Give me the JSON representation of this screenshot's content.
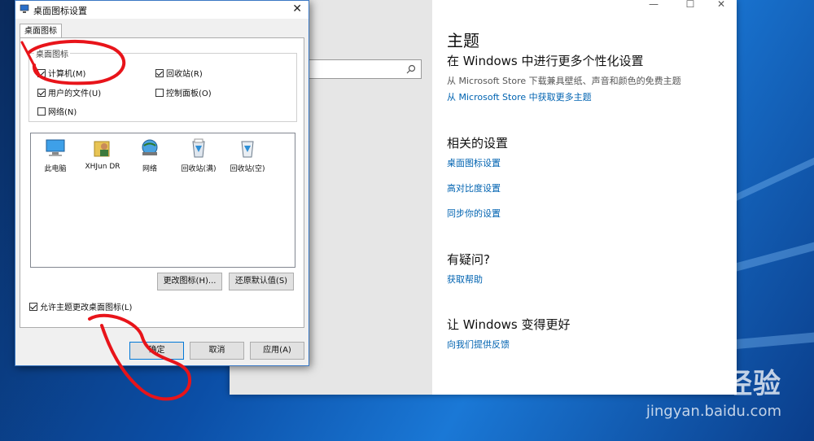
{
  "settings": {
    "page_title": "主题",
    "personalize_heading": "在 Windows 中进行更多个性化设置",
    "store_desc": "从 Microsoft Store 下载兼具壁纸、声音和颜色的免费主题",
    "store_link": "从 Microsoft Store 中获取更多主题",
    "related_heading": "相关的设置",
    "related_links": [
      "桌面图标设置",
      "高对比度设置",
      "同步你的设置"
    ],
    "question_heading": "有疑问?",
    "help_link": "获取帮助",
    "improve_heading": "让 Windows 变得更好",
    "feedback_link": "向我们提供反馈",
    "controls": {
      "minimize": "—",
      "maximize": "☐",
      "close": "✕"
    }
  },
  "dialog": {
    "title": "桌面图标设置",
    "tab": "桌面图标",
    "group_label": "桌面图标",
    "checkboxes": [
      {
        "label": "计算机(M)",
        "checked": true
      },
      {
        "label": "回收站(R)",
        "checked": true
      },
      {
        "label": "用户的文件(U)",
        "checked": true
      },
      {
        "label": "控制面板(O)",
        "checked": false
      },
      {
        "label": "网络(N)",
        "checked": false
      }
    ],
    "icons": [
      "此电脑",
      "XHJun DR",
      "网络",
      "回收站(满)",
      "回收站(空)"
    ],
    "change_icon_button": "更改图标(H)...",
    "restore_default_button": "还原默认值(S)",
    "allow_themes_label": "允许主题更改桌面图标(L)",
    "allow_themes_checked": true,
    "ok_button": "确定",
    "cancel_button": "取消",
    "apply_button": "应用(A)",
    "close": "✕"
  },
  "watermark": {
    "logo": "Baidu经验",
    "url": "jingyan.baidu.com"
  },
  "colors": {
    "link": "#0063b1",
    "annotation": "#e8141a",
    "desktop": "#0b4ea6"
  }
}
